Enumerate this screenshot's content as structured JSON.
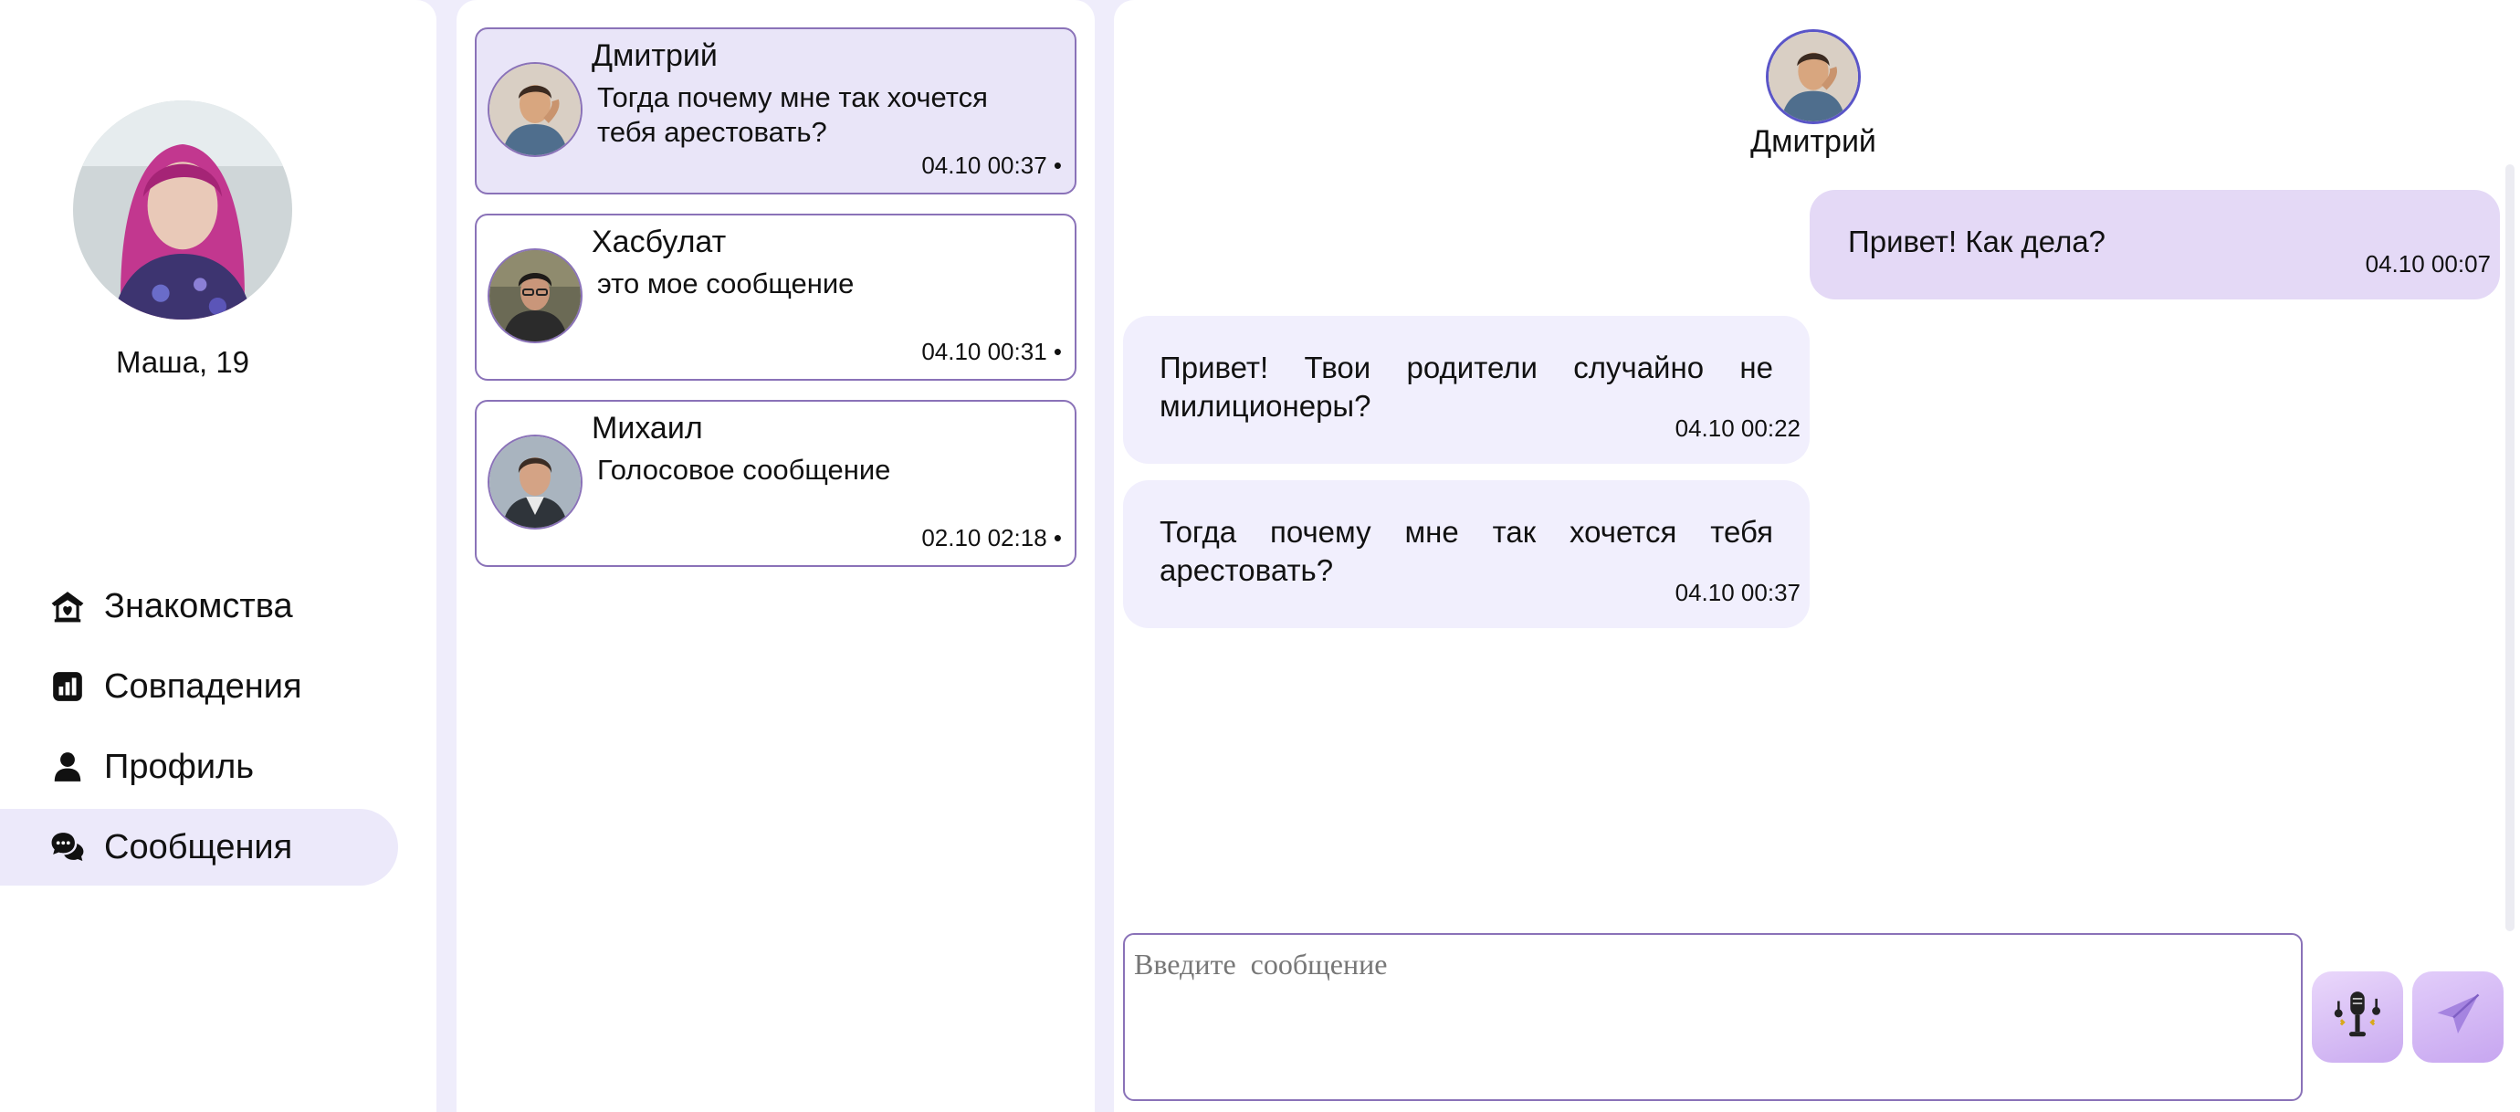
{
  "profile": {
    "name": "Маша, 19"
  },
  "nav": {
    "items": [
      {
        "label": "Знакомства",
        "icon": "home-heart-icon",
        "active": false
      },
      {
        "label": "Совпадения",
        "icon": "bar-chart-icon",
        "active": false
      },
      {
        "label": "Профиль",
        "icon": "person-icon",
        "active": false
      },
      {
        "label": "Сообщения",
        "icon": "chat-bubbles-icon",
        "active": true
      }
    ]
  },
  "chats": [
    {
      "name": "Дмитрий",
      "preview": "Тогда почему мне так хочется тебя арестовать?",
      "time": "04.10 00:37",
      "active": true
    },
    {
      "name": "Хасбулат",
      "preview": "это мое сообщение",
      "time": "04.10 00:31",
      "active": false
    },
    {
      "name": "Михаил",
      "preview": "Голосовое сообщение",
      "time": "02.10 02:18",
      "active": false
    }
  ],
  "conversation": {
    "partner": "Дмитрий",
    "messages": [
      {
        "direction": "out",
        "text": "Привет! Как дела?",
        "time": "04.10 00:07"
      },
      {
        "direction": "in",
        "text": "Привет! Твои родители случайно не милиционеры?",
        "time": "04.10 00:22"
      },
      {
        "direction": "in",
        "text": "Тогда почему мне так хочется тебя арестовать?",
        "time": "04.10 00:37"
      }
    ]
  },
  "composer": {
    "placeholder": "Введите  сообщение"
  },
  "colors": {
    "accent": "#8a72b8",
    "active_bg": "#e9e5f8",
    "out_bubble": "#e4d9f6",
    "in_bubble": "#f1effd",
    "page_bg": "#efedfb"
  }
}
